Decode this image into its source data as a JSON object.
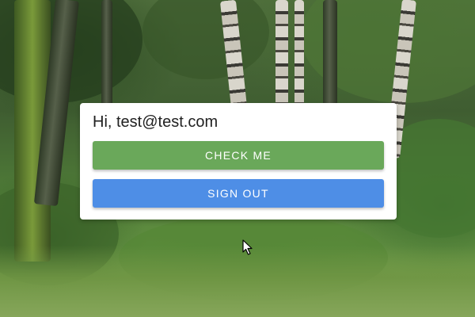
{
  "card": {
    "greeting": "Hi, test@test.com",
    "check_button_label": "CHECK ME",
    "signout_button_label": "SIGN OUT"
  },
  "colors": {
    "check_button": "#6aa85a",
    "signout_button": "#4e8ee6",
    "card_background": "#ffffff",
    "greeting_text": "#212121"
  },
  "background": {
    "description": "forest-photo"
  },
  "cursor": {
    "icon": "mouse-pointer-icon"
  }
}
